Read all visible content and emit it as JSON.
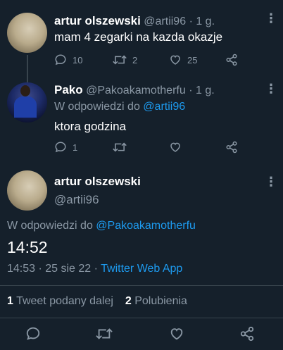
{
  "tweet1": {
    "name": "artur olszewski",
    "handle": "@artii96",
    "time": "· 1 g.",
    "text": "mam 4 zegarki  na kazda okazje",
    "replies": "10",
    "retweets": "2",
    "likes": "25"
  },
  "tweet2": {
    "name": "Pako",
    "handle": "@Pakoakamotherfu",
    "time": "· 1 g.",
    "reply_prefix": "W odpowiedzi do ",
    "reply_to": "@artii96",
    "text": "ktora godzina",
    "replies": "1"
  },
  "main": {
    "name": "artur olszewski",
    "handle": "@artii96",
    "reply_prefix": "W odpowiedzi do ",
    "reply_to": "@Pakoakamotherfu",
    "text": "14:52",
    "time_date": "14:53 · 25 sie 22 · ",
    "source": "Twitter Web App",
    "retweet_count": "1",
    "retweet_label": " Tweet podany dalej",
    "like_count": "2",
    "like_label": " Polubienia"
  },
  "icons": {
    "reply": "reply-icon",
    "retweet": "retweet-icon",
    "like": "heart-icon",
    "share": "share-icon",
    "more": "more-icon"
  },
  "colors": {
    "background": "#15202b",
    "text": "#ffffff",
    "muted": "#8b98a5",
    "link": "#1d9bf0",
    "divider": "#38444d"
  }
}
